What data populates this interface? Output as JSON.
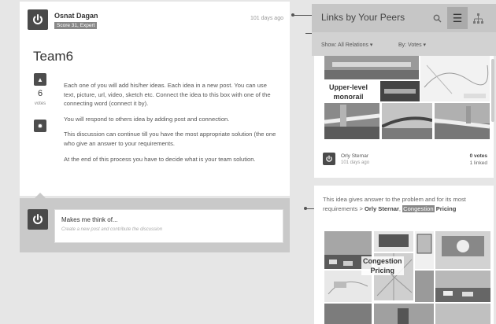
{
  "post": {
    "author": "Osnat Dagan",
    "badge": "Score 31, Expert",
    "time": "101 days ago",
    "title": "Team6",
    "votes": "6",
    "votes_label": "votes",
    "paragraphs": [
      "Each one of you will add his/her ideas. Each idea in a new post. You can use text, picture, url, video, sketch etc. Connect the idea to this box with one of the connecting word (connect it by).",
      "You will respond to others idea by adding post and connection.",
      "This discussion can continue till you have the most appropriate solution (the one who give an answer to your requirements.",
      "At the end of this process you have to decide what is your team solution."
    ]
  },
  "composer": {
    "title": "Makes me think of...",
    "hint": "Create a new post and contribute the discussion"
  },
  "panel": {
    "title": "Links by Your Peers",
    "icons": [
      "search-icon",
      "list-icon",
      "tree-icon"
    ],
    "filter_relations": "Show: All Relations ▾",
    "filter_sort": "By: Votes ▾"
  },
  "card1": {
    "image_caption_lines": [
      "Upper-level",
      "monorail"
    ],
    "author": "Orly Sternar",
    "time": "101 days ago",
    "votes": "0 votes",
    "links": "1 linked"
  },
  "card2": {
    "text_start": "This idea gives answer to the problem and for its most requirements ",
    "arrow": ">",
    "author": "Orly Sternar",
    "highlight": "Congestion",
    "text_end": "Pricing",
    "image_caption_lines": [
      "Congestion",
      "Pricing"
    ]
  },
  "colors": {
    "avatar": "#4a4a4a",
    "panel_header": "#c6c6c6",
    "highlight": "#888888"
  }
}
